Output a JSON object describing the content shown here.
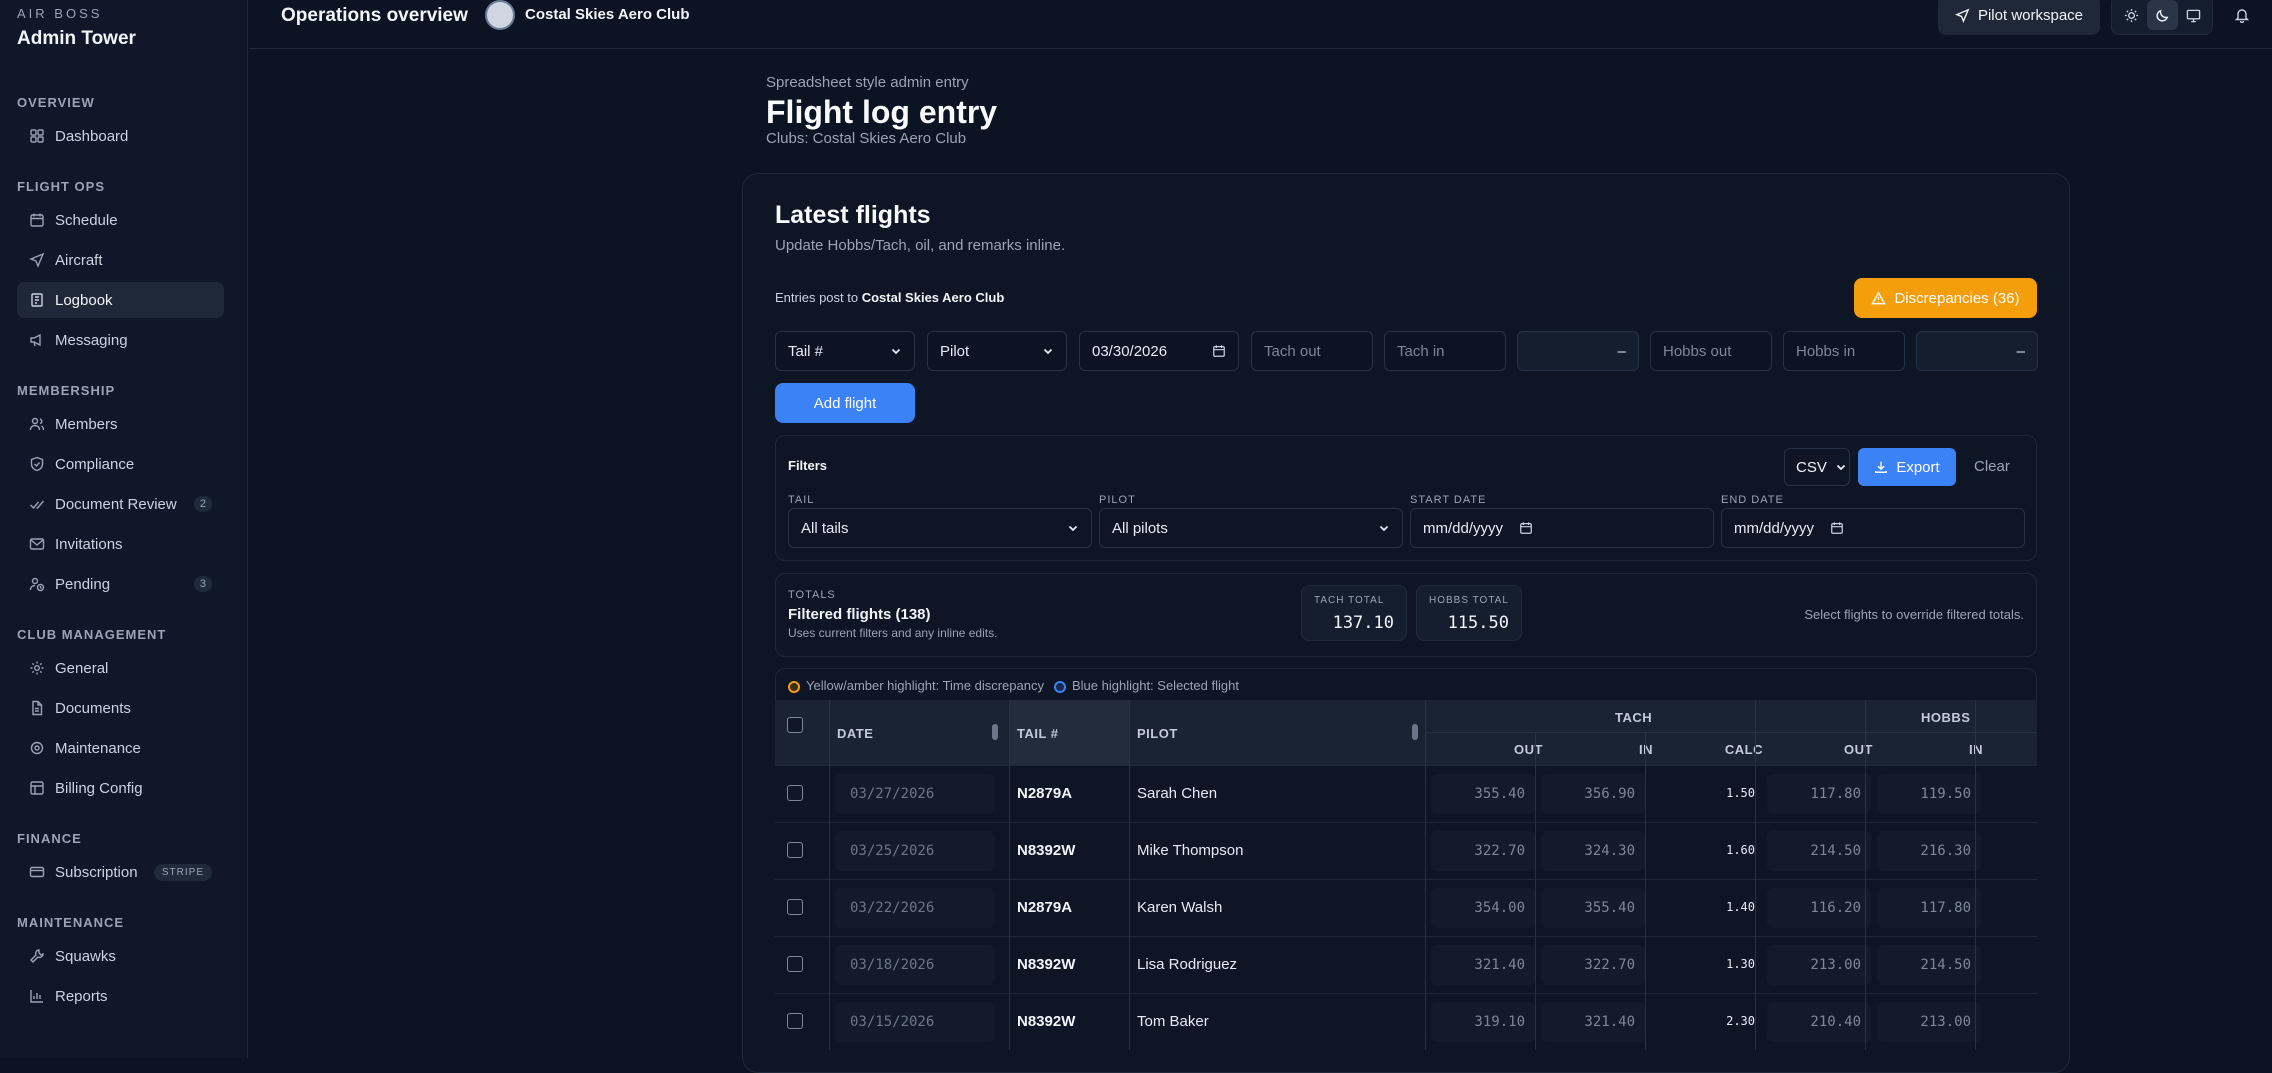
{
  "brand": {
    "small": "AIR BOSS",
    "name": "Admin Tower"
  },
  "sidebar": {
    "overview": {
      "title": "OVERVIEW",
      "items": [
        {
          "label": "Dashboard"
        }
      ]
    },
    "flight_ops": {
      "title": "FLIGHT OPS",
      "items": [
        {
          "label": "Schedule"
        },
        {
          "label": "Aircraft"
        },
        {
          "label": "Logbook"
        },
        {
          "label": "Messaging"
        }
      ]
    },
    "membership": {
      "title": "MEMBERSHIP",
      "items": [
        {
          "label": "Members"
        },
        {
          "label": "Compliance"
        },
        {
          "label": "Document Review",
          "badge": "2"
        },
        {
          "label": "Invitations"
        },
        {
          "label": "Pending",
          "badge": "3"
        }
      ]
    },
    "club": {
      "title": "CLUB MANAGEMENT",
      "items": [
        {
          "label": "General"
        },
        {
          "label": "Documents"
        },
        {
          "label": "Maintenance"
        },
        {
          "label": "Billing Config"
        }
      ]
    },
    "finance": {
      "title": "FINANCE",
      "items": [
        {
          "label": "Subscription",
          "badge": "STRIPE"
        }
      ]
    },
    "maintenance": {
      "title": "MAINTENANCE",
      "items": [
        {
          "label": "Squawks"
        },
        {
          "label": "Reports"
        }
      ]
    }
  },
  "topbar": {
    "title": "Operations overview",
    "club": "Costal Skies Aero Club",
    "workspace_button": "Pilot workspace"
  },
  "page": {
    "eyebrow": "Spreadsheet style admin entry",
    "title": "Flight log entry",
    "clubs": "Clubs: Costal Skies Aero Club"
  },
  "card": {
    "title": "Latest flights",
    "subtitle": "Update Hobbs/Tach, oil, and remarks inline.",
    "post_prefix": "Entries post to ",
    "post_club": "Costal Skies Aero Club",
    "discrepancies": "Discrepancies (36)"
  },
  "entry": {
    "tail": "Tail #",
    "pilot": "Pilot",
    "date": "03/30/2026",
    "tach_out": "Tach out",
    "tach_in": "Tach in",
    "tach_calc": "–",
    "hobbs_out": "Hobbs out",
    "hobbs_in": "Hobbs in",
    "hobbs_calc": "–",
    "add": "Add flight"
  },
  "filters": {
    "title": "Filters",
    "format": "CSV",
    "export": "Export",
    "clear": "Clear",
    "tail_label": "TAIL",
    "tail_value": "All tails",
    "pilot_label": "PILOT",
    "pilot_value": "All pilots",
    "start_label": "START DATE",
    "start_ph": "mm/dd/yyyy",
    "end_label": "END DATE",
    "end_ph": "mm/dd/yyyy"
  },
  "totals": {
    "label": "TOTALS",
    "heading": "Filtered flights (138)",
    "note": "Uses current filters and any inline edits.",
    "tach_label": "TACH TOTAL",
    "tach_value": "137.10",
    "hobbs_label": "HOBBS TOTAL",
    "hobbs_value": "115.50",
    "hint": "Select flights to override filtered totals."
  },
  "legend": {
    "amber": "Yellow/amber highlight: Time discrepancy",
    "blue": "Blue highlight: Selected flight",
    "amber_color": "#f59e0b",
    "blue_color": "#3b82f6"
  },
  "table": {
    "headers": {
      "date": "DATE",
      "tail": "TAIL #",
      "pilot": "PILOT",
      "tach": "TACH",
      "hobbs": "HOBBS",
      "out": "OUT",
      "in": "IN",
      "calc": "CALC"
    },
    "rows": [
      {
        "date": "03/27/2026",
        "tail": "N2879A",
        "pilot": "Sarah Chen",
        "tach_out": "355.40",
        "tach_in": "356.90",
        "calc": "1.50",
        "hobbs_out": "117.80",
        "hobbs_in": "119.50"
      },
      {
        "date": "03/25/2026",
        "tail": "N8392W",
        "pilot": "Mike Thompson",
        "tach_out": "322.70",
        "tach_in": "324.30",
        "calc": "1.60",
        "hobbs_out": "214.50",
        "hobbs_in": "216.30"
      },
      {
        "date": "03/22/2026",
        "tail": "N2879A",
        "pilot": "Karen Walsh",
        "tach_out": "354.00",
        "tach_in": "355.40",
        "calc": "1.40",
        "hobbs_out": "116.20",
        "hobbs_in": "117.80"
      },
      {
        "date": "03/18/2026",
        "tail": "N8392W",
        "pilot": "Lisa Rodriguez",
        "tach_out": "321.40",
        "tach_in": "322.70",
        "calc": "1.30",
        "hobbs_out": "213.00",
        "hobbs_in": "214.50"
      },
      {
        "date": "03/15/2026",
        "tail": "N8392W",
        "pilot": "Tom Baker",
        "tach_out": "319.10",
        "tach_in": "321.40",
        "calc": "2.30",
        "hobbs_out": "210.40",
        "hobbs_in": "213.00"
      }
    ]
  }
}
